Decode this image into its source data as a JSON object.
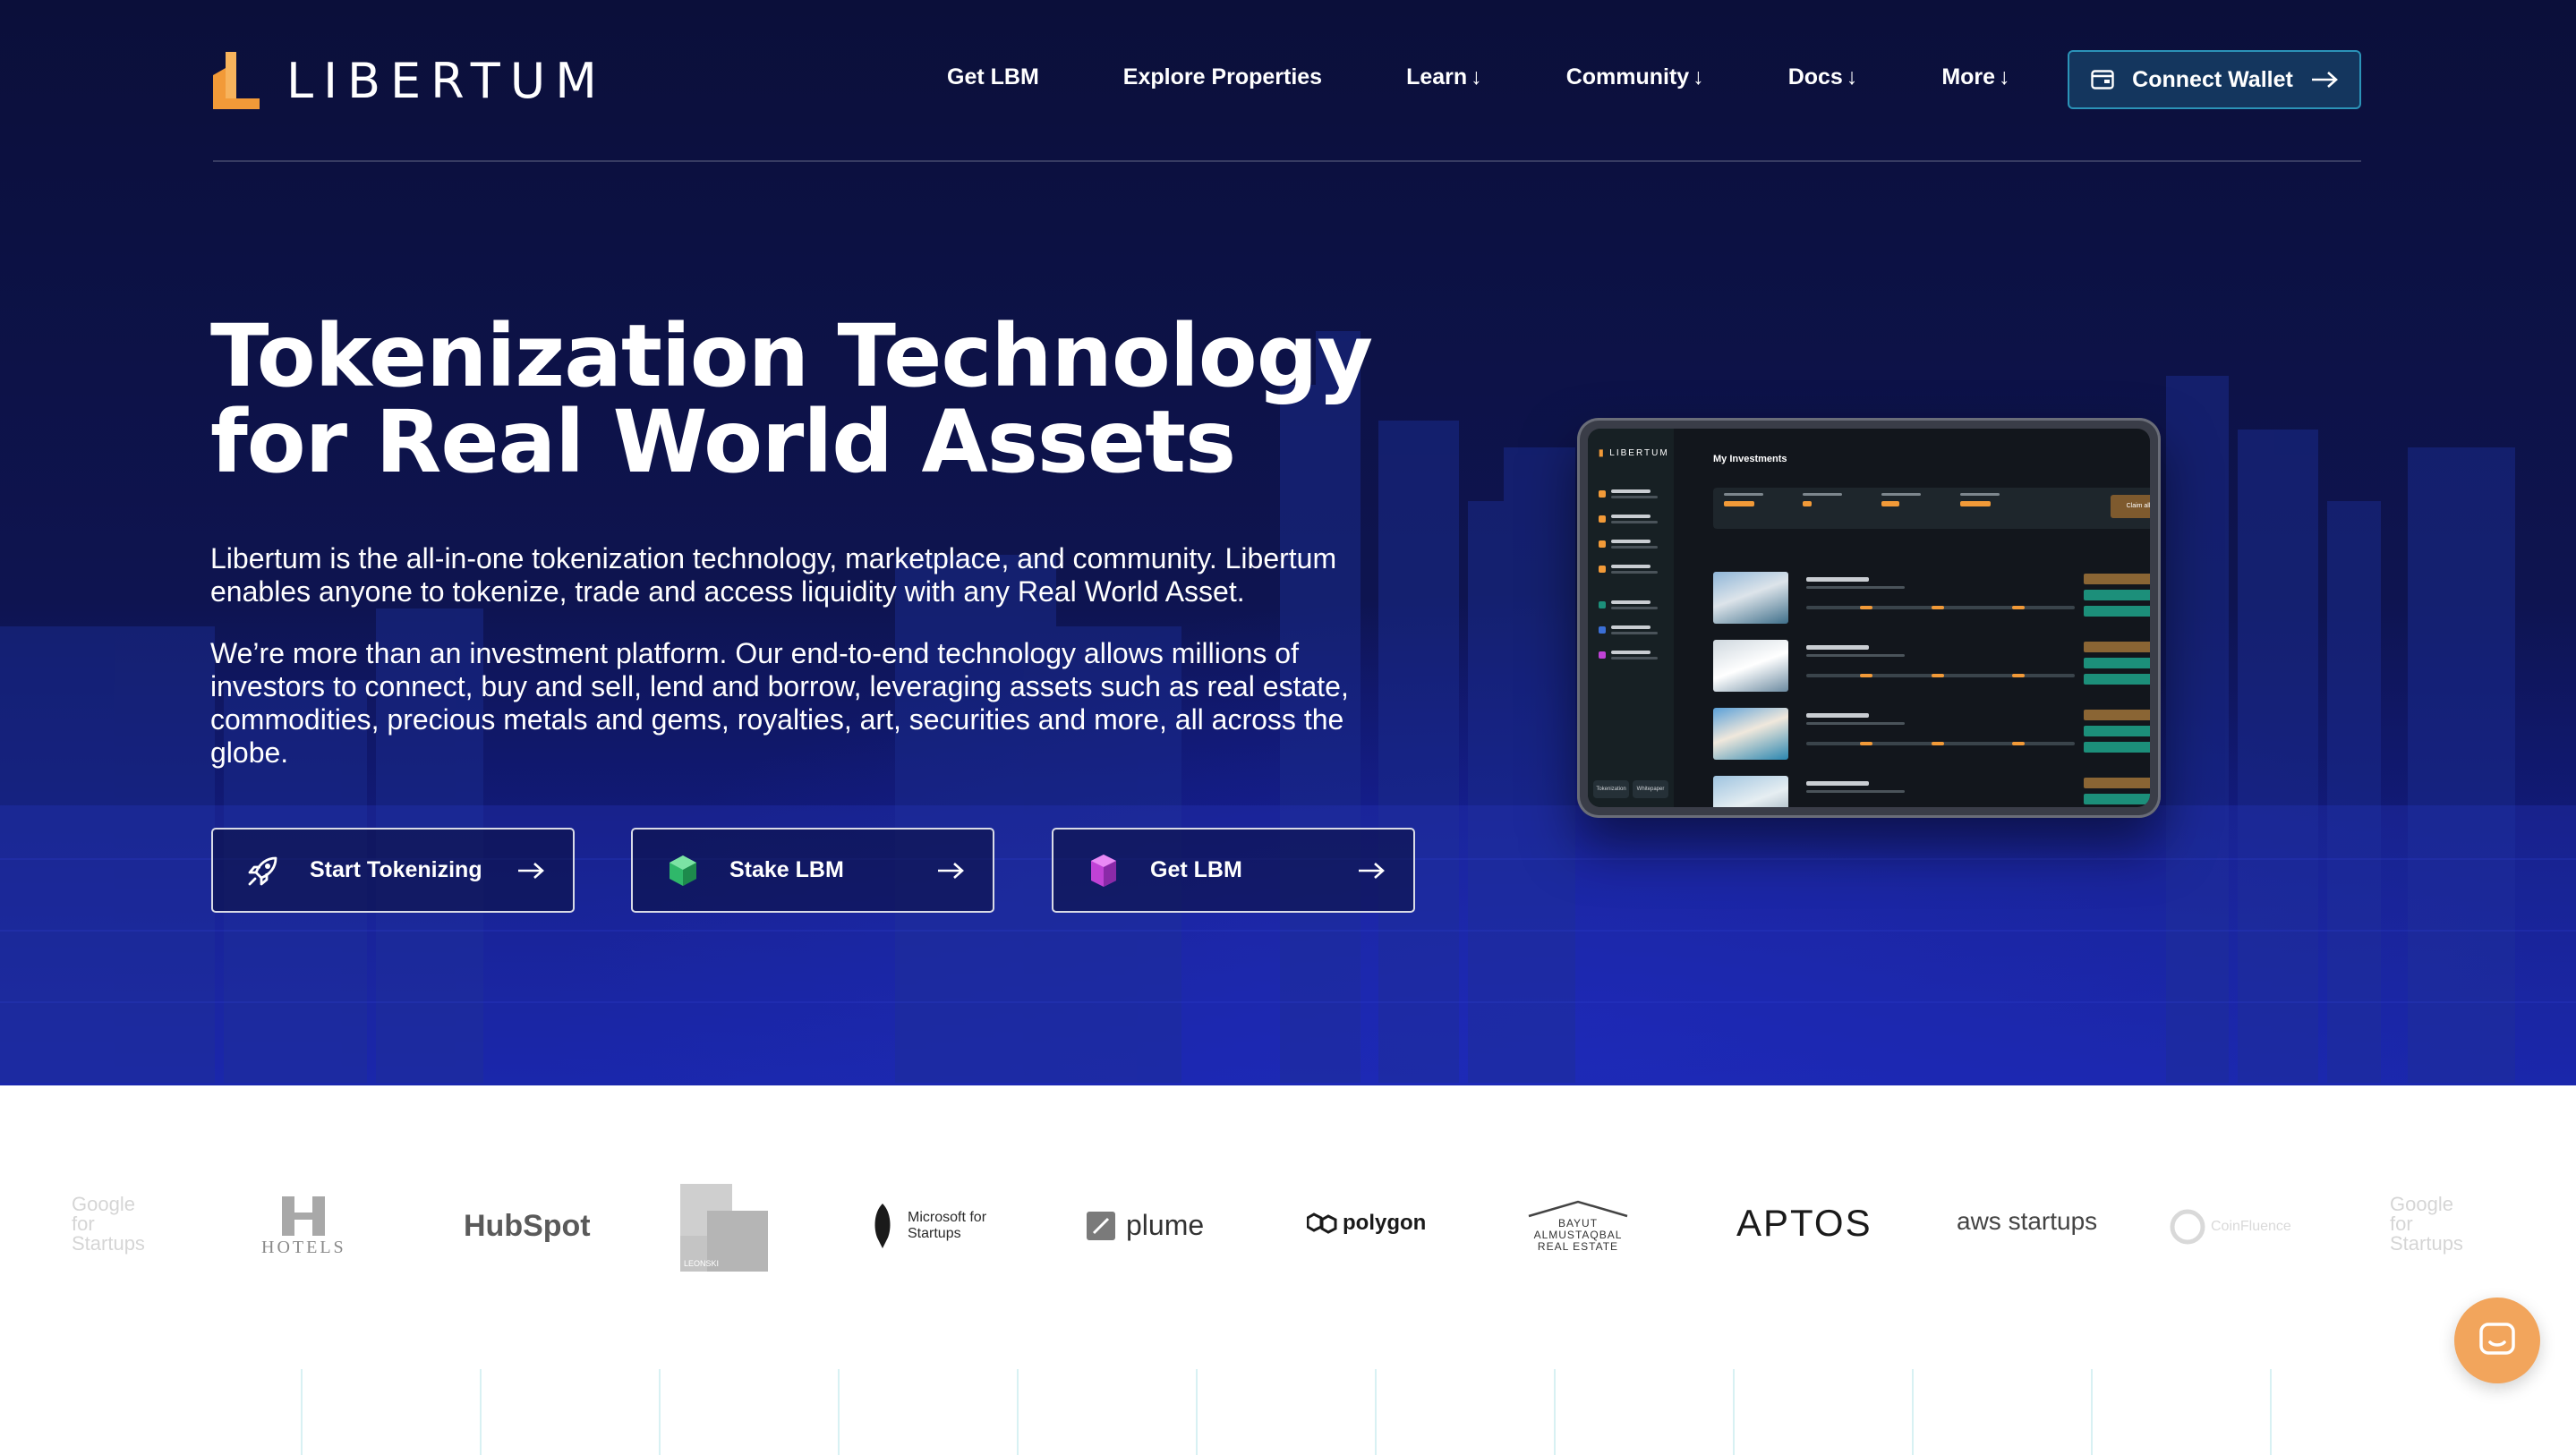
{
  "brand": {
    "name": "LIBERTUM",
    "accent": "#f29a38"
  },
  "nav": {
    "items": [
      {
        "label": "Get LBM",
        "dropdown": false
      },
      {
        "label": "Explore Properties",
        "dropdown": false
      },
      {
        "label": "Learn",
        "dropdown": true
      },
      {
        "label": "Community",
        "dropdown": true
      },
      {
        "label": "Docs",
        "dropdown": true
      },
      {
        "label": "More",
        "dropdown": true
      }
    ],
    "connect_wallet": "Connect Wallet"
  },
  "hero": {
    "title_line1": "Tokenization Technology",
    "title_line2": "for Real World Assets",
    "paragraph1": "Libertum is the all-in-one tokenization technology, marketplace, and community. Libertum enables anyone to tokenize, trade and access liquidity with any Real World Asset.",
    "paragraph2": "We’re more than an investment platform. Our end-to-end technology allows millions of investors to connect, buy and sell, lend and borrow, leveraging assets such as real estate, commodities, precious metals and gems, royalties, art, securities and more, all across the globe.",
    "buttons": [
      {
        "label": "Start Tokenizing",
        "icon": "rocket-icon"
      },
      {
        "label": "Stake LBM",
        "icon": "green-cube-icon"
      },
      {
        "label": "Get LBM",
        "icon": "pink-cube-icon"
      }
    ]
  },
  "mockup": {
    "logo": "LIBERTUM",
    "page_title": "My Investments",
    "claim_label": "Claim all",
    "footer_tabs": [
      "Tokenization",
      "Whitepaper"
    ]
  },
  "partners": [
    {
      "name": "Google for Startups",
      "faded": true
    },
    {
      "name": "HOTELS",
      "faded": false
    },
    {
      "name": "HubSpot",
      "faded": false
    },
    {
      "name": "LEONSKI",
      "faded": false
    },
    {
      "name": "Microsoft for Startups",
      "faded": false
    },
    {
      "name": "plume",
      "faded": false
    },
    {
      "name": "polygon",
      "faded": false
    },
    {
      "name": "BAYUT ALMUSTAQBAL REAL ESTATE",
      "faded": false
    },
    {
      "name": "APTOS",
      "faded": false
    },
    {
      "name": "aws startups",
      "faded": false
    },
    {
      "name": "CoinFluence",
      "faded": true
    },
    {
      "name": "Google for Startups",
      "faded": true
    }
  ],
  "chat": {
    "icon": "chat-bubble-icon"
  }
}
